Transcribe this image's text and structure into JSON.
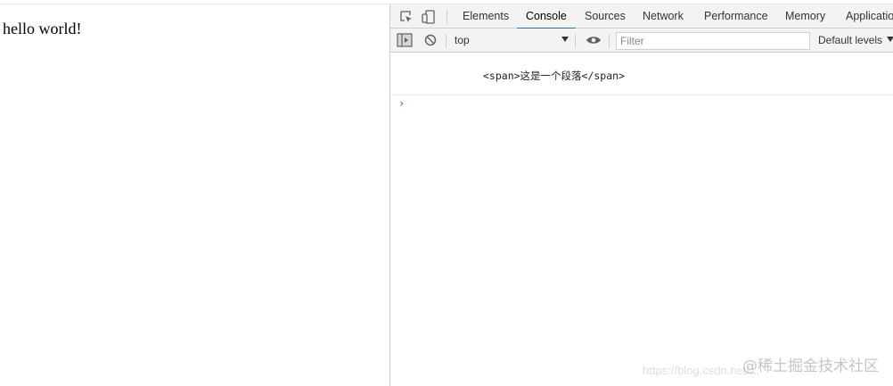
{
  "page": {
    "content": "hello world!"
  },
  "devtools": {
    "tabs": [
      "Elements",
      "Console",
      "Sources",
      "Network",
      "Performance",
      "Memory",
      "Applicatio"
    ],
    "active_tab": "Console",
    "toolbar": {
      "context": "top",
      "filter_placeholder": "Filter",
      "levels": "Default levels"
    },
    "console": {
      "log_message": "<span>这是一个段落</span>",
      "prompt": "›"
    },
    "icons": {
      "inspect": "inspect-element-icon",
      "device": "device-toolbar-icon",
      "sidebar": "show-sidebar-icon",
      "clear": "clear-console-icon",
      "eye": "live-expression-icon"
    },
    "colors": {
      "accent": "#1a73e8"
    }
  },
  "watermark": {
    "text": "@稀土掘金技术社区",
    "url": "https://blog.csdn.net/..."
  }
}
